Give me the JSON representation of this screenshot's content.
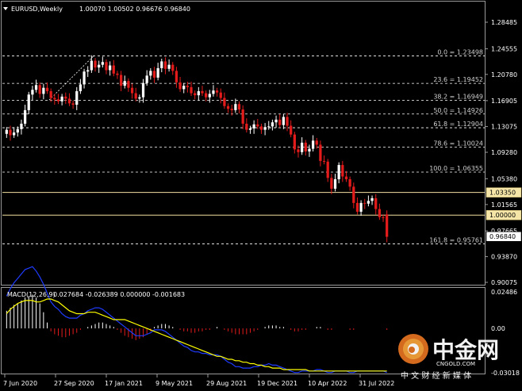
{
  "symbol_header": {
    "title": "EURUSD,Weekly",
    "ohlc": "1.00070 1.00502 0.96676 0.96840"
  },
  "macd_header": {
    "label": "MACD(12,26,9)",
    "values": "0.027684 -0.026389 0.000000 -0.001683"
  },
  "colors": {
    "background": "#000000",
    "bull": "#ffffff",
    "bear": "#e31b1b",
    "grid": "#ffffff",
    "level_line": "#f0e0a0",
    "signal": "#ffff00",
    "macd_line": "#1f3cff",
    "hist_pos": "#ffffff",
    "hist_neg": "#e31b1b"
  },
  "price_axis": {
    "ticks": [
      "1.28485",
      "1.24555",
      "1.20780",
      "1.16905",
      "1.13075",
      "1.09280",
      "1.05380",
      "1.01565",
      "0.97665",
      "0.93870",
      "0.90075"
    ],
    "badges": [
      {
        "text": "1.03350",
        "kind": "level"
      },
      {
        "text": "1.00000",
        "kind": "level"
      },
      {
        "text": "0.96840",
        "kind": "last"
      }
    ]
  },
  "fib_levels": [
    {
      "label": "0.0 = 1.23498",
      "price": 1.23498
    },
    {
      "label": "23.6 = 1.19452",
      "price": 1.19452
    },
    {
      "label": "38.2 = 1.16949",
      "price": 1.16949
    },
    {
      "label": "50.0 = 1.14926",
      "price": 1.14926
    },
    {
      "label": "61.8 = 1.12904",
      "price": 1.12904
    },
    {
      "label": "78.6 = 1.10024",
      "price": 1.10024
    },
    {
      "label": "100.0 = 1.06355",
      "price": 1.06355
    },
    {
      "label": "161.8 = 0.95761",
      "price": 0.95761
    }
  ],
  "horizontal_levels": [
    1.0335,
    1.0
  ],
  "macd_axis": {
    "ticks": [
      "0.02486",
      "0.00",
      "-0.03018"
    ]
  },
  "time_axis": {
    "labels": [
      "7 Jun 2020",
      "27 Sep 2020",
      "17 Jan 2021",
      "9 May 2021",
      "29 Aug 2021",
      "19 Dec 2021",
      "10 Apr 2022",
      "31 Jul 2022"
    ]
  },
  "watermark": {
    "brand": "中金网",
    "domain": "CNGOLD.COM",
    "slogan": "中 文 财 经 新 媒 体"
  },
  "chart_data": [
    {
      "type": "candlestick",
      "title": "EURUSD,Weekly",
      "ylim": [
        0.90075,
        1.28485
      ],
      "closes": [
        1.126,
        1.118,
        1.122,
        1.127,
        1.135,
        1.155,
        1.178,
        1.185,
        1.192,
        1.179,
        1.188,
        1.183,
        1.173,
        1.171,
        1.168,
        1.175,
        1.172,
        1.165,
        1.163,
        1.183,
        1.193,
        1.212,
        1.214,
        1.228,
        1.218,
        1.222,
        1.226,
        1.214,
        1.221,
        1.209,
        1.207,
        1.191,
        1.198,
        1.188,
        1.18,
        1.172,
        1.174,
        1.195,
        1.206,
        1.213,
        1.203,
        1.217,
        1.227,
        1.216,
        1.222,
        1.213,
        1.196,
        1.186,
        1.191,
        1.189,
        1.18,
        1.177,
        1.183,
        1.18,
        1.174,
        1.179,
        1.184,
        1.181,
        1.173,
        1.161,
        1.157,
        1.155,
        1.164,
        1.156,
        1.135,
        1.126,
        1.128,
        1.134,
        1.131,
        1.126,
        1.13,
        1.131,
        1.137,
        1.141,
        1.133,
        1.145,
        1.132,
        1.119,
        1.097,
        1.093,
        1.107,
        1.094,
        1.098,
        1.11,
        1.104,
        1.08,
        1.079,
        1.055,
        1.039,
        1.053,
        1.074,
        1.057,
        1.053,
        1.042,
        1.018,
        1.005,
        1.018,
        1.017,
        1.021,
        1.025,
        1.009,
        0.997,
        0.996,
        0.968
      ],
      "opens": [
        1.12,
        1.126,
        1.118,
        1.122,
        1.127,
        1.135,
        1.155,
        1.178,
        1.185,
        1.192,
        1.179,
        1.188,
        1.183,
        1.173,
        1.171,
        1.168,
        1.175,
        1.172,
        1.165,
        1.163,
        1.183,
        1.193,
        1.212,
        1.214,
        1.228,
        1.218,
        1.222,
        1.226,
        1.214,
        1.221,
        1.209,
        1.207,
        1.191,
        1.198,
        1.188,
        1.18,
        1.172,
        1.174,
        1.195,
        1.206,
        1.213,
        1.203,
        1.217,
        1.227,
        1.216,
        1.222,
        1.213,
        1.196,
        1.186,
        1.191,
        1.189,
        1.18,
        1.177,
        1.183,
        1.18,
        1.174,
        1.179,
        1.184,
        1.181,
        1.173,
        1.161,
        1.157,
        1.155,
        1.164,
        1.156,
        1.135,
        1.126,
        1.128,
        1.134,
        1.131,
        1.126,
        1.13,
        1.131,
        1.137,
        1.141,
        1.133,
        1.145,
        1.132,
        1.119,
        1.097,
        1.093,
        1.107,
        1.094,
        1.098,
        1.11,
        1.104,
        1.08,
        1.079,
        1.055,
        1.039,
        1.053,
        1.074,
        1.057,
        1.053,
        1.042,
        1.018,
        1.005,
        1.018,
        1.017,
        1.021,
        1.025,
        1.009,
        0.997,
        1.001
      ]
    },
    {
      "type": "bar",
      "title": "MACD(12,26,9)",
      "ylim": [
        -0.03018,
        0.02486
      ],
      "histogram": [
        0.012,
        0.014,
        0.016,
        0.017,
        0.019,
        0.021,
        0.022,
        0.023,
        0.021,
        0.017,
        0.011,
        0.004,
        -0.002,
        -0.004,
        -0.005,
        -0.006,
        -0.006,
        -0.005,
        -0.004,
        -0.003,
        -0.001,
        0.0,
        0.001,
        0.002,
        0.003,
        0.004,
        0.004,
        0.003,
        0.002,
        0.001,
        -0.001,
        -0.003,
        -0.005,
        -0.006,
        -0.007,
        -0.008,
        -0.007,
        -0.006,
        -0.004,
        -0.002,
        0.001,
        0.002,
        0.003,
        0.003,
        0.002,
        0.001,
        0.0,
        -0.001,
        -0.002,
        -0.002,
        -0.003,
        -0.003,
        -0.002,
        -0.002,
        -0.001,
        -0.001,
        0.0,
        0.001,
        0.0,
        -0.001,
        -0.002,
        -0.003,
        -0.004,
        -0.004,
        -0.004,
        -0.004,
        -0.003,
        -0.002,
        -0.001,
        0.0,
        0.001,
        0.002,
        0.002,
        0.002,
        0.001,
        0.001,
        0.0,
        -0.001,
        -0.002,
        -0.002,
        -0.001,
        -0.001,
        0.0,
        0.0,
        0.001,
        0.001,
        0.0,
        -0.001,
        -0.001,
        0.0,
        0.0,
        0.0,
        0.0,
        -0.001,
        -0.001,
        0.0,
        0.0,
        0.0,
        0.0,
        0.0,
        0.0,
        0.0,
        0.0,
        -0.001
      ],
      "signal": [
        0.01,
        0.013,
        0.015,
        0.017,
        0.018,
        0.019,
        0.019,
        0.019,
        0.018,
        0.018,
        0.019,
        0.02,
        0.02,
        0.019,
        0.018,
        0.016,
        0.014,
        0.012,
        0.011,
        0.01,
        0.01,
        0.01,
        0.011,
        0.011,
        0.011,
        0.01,
        0.009,
        0.008,
        0.007,
        0.006,
        0.006,
        0.006,
        0.006,
        0.005,
        0.004,
        0.003,
        0.002,
        0.001,
        0.0,
        -0.001,
        -0.002,
        -0.003,
        -0.004,
        -0.005,
        -0.006,
        -0.007,
        -0.008,
        -0.009,
        -0.01,
        -0.011,
        -0.012,
        -0.013,
        -0.014,
        -0.015,
        -0.016,
        -0.017,
        -0.018,
        -0.019,
        -0.019,
        -0.02,
        -0.021,
        -0.021,
        -0.022,
        -0.022,
        -0.023,
        -0.023,
        -0.024,
        -0.024,
        -0.025,
        -0.025,
        -0.026,
        -0.026,
        -0.027,
        -0.027,
        -0.027,
        -0.028,
        -0.028,
        -0.028,
        -0.028,
        -0.028,
        -0.028,
        -0.028,
        -0.029,
        -0.029,
        -0.029,
        -0.029,
        -0.029,
        -0.029,
        -0.029,
        -0.029,
        -0.029,
        -0.029,
        -0.029,
        -0.029,
        -0.029,
        -0.029,
        -0.029,
        -0.029,
        -0.029,
        -0.029,
        -0.029,
        -0.029,
        -0.029,
        -0.029
      ],
      "macd": [
        0.022,
        0.027,
        0.031,
        0.034,
        0.037,
        0.04,
        0.041,
        0.042,
        0.039,
        0.035,
        0.03,
        0.024,
        0.018,
        0.015,
        0.013,
        0.01,
        0.008,
        0.007,
        0.007,
        0.007,
        0.009,
        0.01,
        0.012,
        0.013,
        0.014,
        0.014,
        0.013,
        0.011,
        0.009,
        0.007,
        0.005,
        0.003,
        0.001,
        -0.001,
        -0.003,
        -0.005,
        -0.005,
        -0.005,
        -0.004,
        -0.003,
        -0.001,
        -0.001,
        -0.001,
        -0.002,
        -0.004,
        -0.006,
        -0.008,
        -0.01,
        -0.012,
        -0.013,
        -0.015,
        -0.016,
        -0.016,
        -0.017,
        -0.017,
        -0.018,
        -0.018,
        -0.018,
        -0.019,
        -0.021,
        -0.023,
        -0.024,
        -0.026,
        -0.026,
        -0.027,
        -0.027,
        -0.027,
        -0.026,
        -0.026,
        -0.025,
        -0.025,
        -0.024,
        -0.025,
        -0.025,
        -0.026,
        -0.027,
        -0.028,
        -0.029,
        -0.03,
        -0.03,
        -0.029,
        -0.029,
        -0.029,
        -0.029,
        -0.028,
        -0.028,
        -0.029,
        -0.03,
        -0.03,
        -0.029,
        -0.029,
        -0.029,
        -0.029,
        -0.03,
        -0.03,
        -0.029,
        -0.029,
        -0.029,
        -0.029,
        -0.029,
        -0.029,
        -0.029,
        -0.029,
        -0.03
      ]
    }
  ]
}
